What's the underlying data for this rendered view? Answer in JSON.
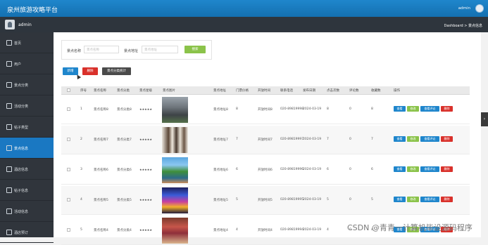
{
  "app": {
    "title": "泉州旅游攻略平台",
    "user": "admin",
    "sub_user": "admin",
    "breadcrumb": "Dashboard > 景点信息"
  },
  "sidebar": {
    "items": [
      {
        "label": "首页",
        "icon": "home-icon"
      },
      {
        "label": "用户",
        "icon": "user-icon"
      },
      {
        "label": "景点分类",
        "icon": "category-icon"
      },
      {
        "label": "活动分类",
        "icon": "category-icon"
      },
      {
        "label": "帖子类型",
        "icon": "tag-icon"
      },
      {
        "label": "景点信息",
        "icon": "scenic-icon",
        "active": true
      },
      {
        "label": "酒店信息",
        "icon": "hotel-icon"
      },
      {
        "label": "帖子信息",
        "icon": "post-icon"
      },
      {
        "label": "活动信息",
        "icon": "activity-icon"
      },
      {
        "label": "酒店预订",
        "icon": "booking-icon"
      }
    ]
  },
  "search": {
    "name_label": "景点名称",
    "name_placeholder": "景点名称",
    "address_label": "景点地址",
    "address_placeholder": "景点地址",
    "search_button": "搜索"
  },
  "toolbar": {
    "add": "新增",
    "delete": "删除",
    "stats": "景点分类统计"
  },
  "table": {
    "headers": [
      "序号",
      "景点名称",
      "景点分类",
      "景点星级",
      "景点图片",
      "景点地址",
      "门票价格",
      "开放时间",
      "联系电话",
      "发布日期",
      "点击次数",
      "评论数",
      "收藏数",
      "操作"
    ],
    "rows": [
      {
        "no": "1",
        "name": "景点名称8",
        "category": "景点分类8",
        "stars": "★★★★★",
        "address": "景点地址8",
        "price": "8",
        "open": "开放时间8",
        "phone": "020-89819998",
        "date": "2024-03-19",
        "clicks": "8",
        "comments": "0",
        "favorites": "8",
        "img": "rocks"
      },
      {
        "no": "2",
        "name": "景点名称7",
        "category": "景点分类7",
        "stars": "★★★★★",
        "address": "景点地址7",
        "price": "7",
        "open": "开放时间7",
        "phone": "020-89819997",
        "date": "2024-03-19",
        "clicks": "7",
        "comments": "0",
        "favorites": "7",
        "img": "building"
      },
      {
        "no": "3",
        "name": "景点名称6",
        "category": "景点分类6",
        "stars": "★★★★★",
        "address": "景点地址6",
        "price": "6",
        "open": "开放时间6",
        "phone": "020-89819996",
        "date": "2024-03-19",
        "clicks": "6",
        "comments": "0",
        "favorites": "6",
        "img": "river"
      },
      {
        "no": "4",
        "name": "景点名称5",
        "category": "景点分类5",
        "stars": "★★★★★",
        "address": "景点地址5",
        "price": "5",
        "open": "开放时间5",
        "phone": "020-89819995",
        "date": "2024-03-19",
        "clicks": "5",
        "comments": "0",
        "favorites": "5",
        "img": "stage"
      },
      {
        "no": "5",
        "name": "景点名称4",
        "category": "景点分类4",
        "stars": "★★★★★",
        "address": "景点地址4",
        "price": "4",
        "open": "开放时间4",
        "phone": "020-89819994",
        "date": "2024-03-19",
        "clicks": "4",
        "comments": "0",
        "favorites": "4",
        "img": "market"
      }
    ],
    "actions": {
      "view": "查看",
      "edit": "修改",
      "view_comments": "查看评论",
      "delete": "删除"
    }
  },
  "watermark": "CSDN @青青一计算机毕设源码程序",
  "colors": {
    "primary": "#1f86cc",
    "success": "#8bc34a",
    "danger": "#d9312b",
    "sidebar": "#30353c"
  }
}
